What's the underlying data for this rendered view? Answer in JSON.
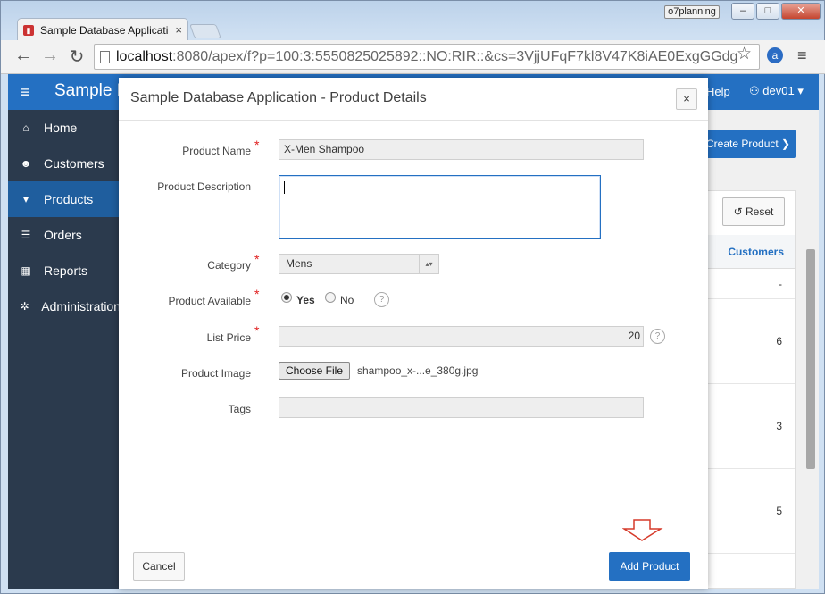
{
  "browser": {
    "tab_title": "Sample Database Applicati",
    "tab_close": "×",
    "profile": "o7planning",
    "win_min": "–",
    "win_max": "□",
    "win_close": "✕",
    "url_host": "localhost",
    "url_path": ":8080/apex/f?p=100:3:5550825025892::NO:RIR::&cs=3VjjUFqF7kl8V47K8iAE0ExgGGdg",
    "back": "←",
    "forward": "→",
    "reload": "↻",
    "star": "☆",
    "ext": "a",
    "menu": "≡"
  },
  "app": {
    "name": "Sample D",
    "help": "Help",
    "user": "dev01 ▾",
    "nav": [
      {
        "label": "Home",
        "icon": "home-icon"
      },
      {
        "label": "Customers",
        "icon": "users-icon"
      },
      {
        "label": "Products",
        "icon": "cart-icon"
      },
      {
        "label": "Orders",
        "icon": "list-icon"
      },
      {
        "label": "Reports",
        "icon": "table-icon"
      },
      {
        "label": "Administration",
        "icon": "gear-icon"
      }
    ],
    "create_button": "Create Product ❯",
    "reset_button": "Reset",
    "customers_header": "Customers",
    "customer_cells": [
      "-",
      "6",
      "3",
      "5"
    ]
  },
  "modal": {
    "title": "Sample Database Application - Product Details",
    "close": "×",
    "labels": {
      "name": "Product Name",
      "description": "Product Description",
      "category": "Category",
      "available": "Product Available",
      "price": "List Price",
      "image": "Product Image",
      "tags": "Tags"
    },
    "required_mark": "*",
    "values": {
      "name": "X-Men Shampoo",
      "description": "",
      "category": "Mens",
      "available_yes": "Yes",
      "available_no": "No",
      "price": "20",
      "choose_file": "Choose File",
      "file_name": "shampoo_x-...e_380g.jpg",
      "tags": ""
    },
    "help_glyph": "?",
    "cancel": "Cancel",
    "add": "Add Product"
  }
}
